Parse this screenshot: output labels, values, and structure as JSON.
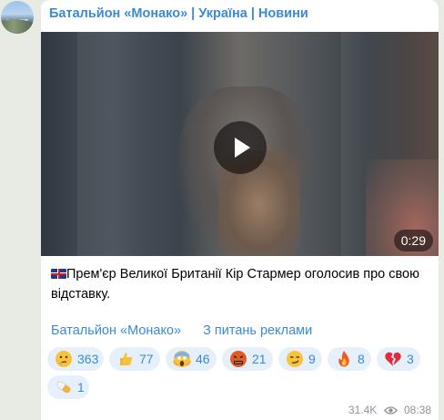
{
  "channel": {
    "name": "Батальйон «Монако» | Україна | Новини"
  },
  "video": {
    "duration": "0:29"
  },
  "post": {
    "flag_icon": "uk-flag-icon",
    "text": "Прем'єр Великої Британії Кір Стармер оголосив про свою відставку."
  },
  "links": {
    "channel_link": "Батальйон «Монако»",
    "ads_link": "З питань реклами"
  },
  "reactions": [
    {
      "icon": "thinking-face-icon",
      "count": "363"
    },
    {
      "icon": "thumbs-up-icon",
      "count": "77"
    },
    {
      "icon": "screaming-face-icon",
      "count": "46"
    },
    {
      "icon": "cursing-face-icon",
      "count": "21"
    },
    {
      "icon": "smirking-face-icon",
      "count": "9"
    },
    {
      "icon": "fire-icon",
      "count": "8"
    },
    {
      "icon": "broken-heart-icon",
      "count": "3"
    },
    {
      "icon": "pill-icon",
      "count": "1"
    }
  ],
  "meta": {
    "views": "31.4K",
    "time": "08:38"
  },
  "colors": {
    "accent": "#3a8ad6",
    "chip_bg": "#e6f0fb",
    "meta": "#8d949b"
  }
}
